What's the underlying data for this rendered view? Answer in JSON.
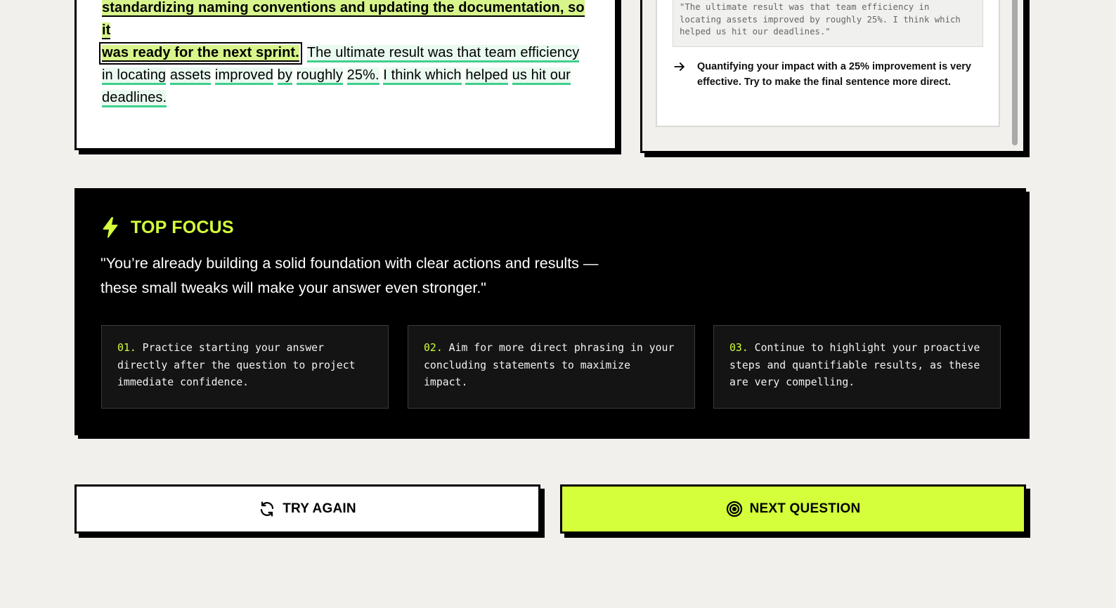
{
  "answer": {
    "line0_tail": "standardizing naming conventions and updating the documentation, so it",
    "highlight_end": "was ready for the next sprint.",
    "underlined_words": [
      "The ultimate result was that team efficiency",
      "in locating",
      "assets",
      "improved",
      "by",
      "roughly",
      "25%.",
      "I think which",
      "helped",
      "us hit our",
      "deadlines."
    ]
  },
  "feedback": {
    "quote": "\"The ultimate result was that team efficiency in locating assets improved by roughly 25%. I think which helped us hit our deadlines.\"",
    "tip": "Quantifying your impact with a 25% improvement is very effective. Try to make the final sentence more direct."
  },
  "focus": {
    "title": "TOP FOCUS",
    "quote": "\"You’re already building a solid foundation with clear actions and results — these small tweaks will make your answer even stronger.\"",
    "items": [
      {
        "num": "01.",
        "text": "Practice starting your answer directly after the question to project immediate confidence."
      },
      {
        "num": "02.",
        "text": "Aim for more direct phrasing in your concluding statements to maximize impact."
      },
      {
        "num": "03.",
        "text": "Continue to highlight your proactive steps and quantifiable results, as these are very compelling."
      }
    ]
  },
  "buttons": {
    "try_again": "TRY AGAIN",
    "next_question": "NEXT QUESTION"
  },
  "colors": {
    "accent": "#d4ff3a",
    "highlight": "#d7f58b",
    "underline": "#3fcf8e",
    "background": "#f1f0ec"
  },
  "icons": {
    "focus": "bolt-icon",
    "try_again": "refresh-icon",
    "next_question": "target-icon",
    "tip": "arrow-right-icon"
  }
}
